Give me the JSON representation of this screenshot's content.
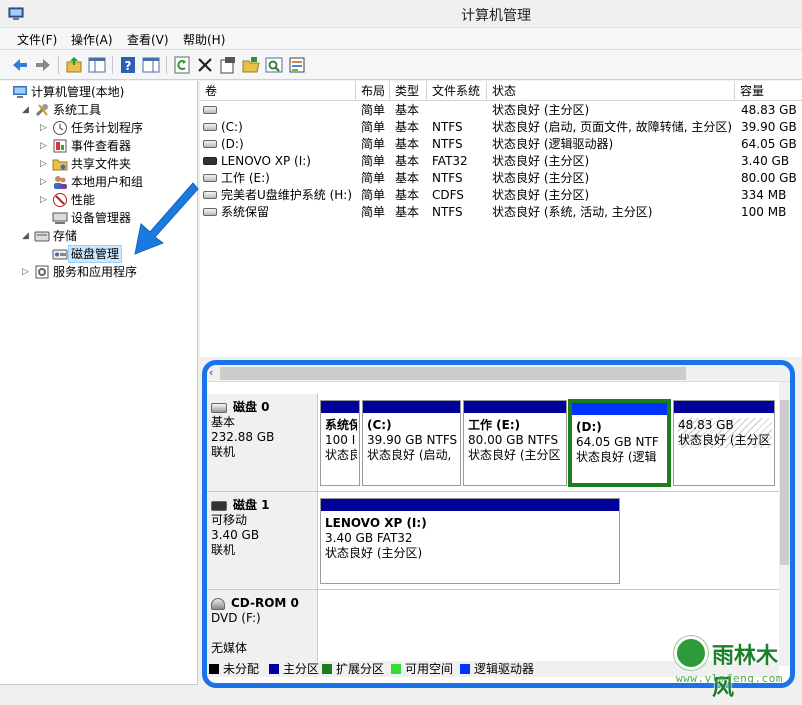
{
  "window": {
    "title": "计算机管理"
  },
  "menu": [
    "文件(F)",
    "操作(A)",
    "查看(V)",
    "帮助(H)"
  ],
  "toolbar": [
    "back-icon",
    "forward-icon",
    "up-folder-icon",
    "show-hide-tree-icon",
    "help-icon",
    "properties-pane-icon",
    "refresh-icon",
    "delete-icon",
    "properties-icon",
    "open-icon",
    "search-icon",
    "settings-icon"
  ],
  "tree": {
    "root": "计算机管理(本地)",
    "system_tools": "系统工具",
    "task_scheduler": "任务计划程序",
    "event_viewer": "事件查看器",
    "shared_folders": "共享文件夹",
    "local_users": "本地用户和组",
    "performance": "性能",
    "device_manager": "设备管理器",
    "storage": "存储",
    "disk_management": "磁盘管理",
    "services": "服务和应用程序"
  },
  "volumes": {
    "headers": [
      "卷",
      "布局",
      "类型",
      "文件系统",
      "状态",
      "容量"
    ],
    "rows": [
      {
        "name": "",
        "layout": "简单",
        "type": "基本",
        "fs": "",
        "status": "状态良好 (主分区)",
        "size": "48.83 GB",
        "usb": false
      },
      {
        "name": "(C:)",
        "layout": "简单",
        "type": "基本",
        "fs": "NTFS",
        "status": "状态良好 (启动, 页面文件, 故障转储, 主分区)",
        "size": "39.90 GB",
        "usb": false
      },
      {
        "name": "(D:)",
        "layout": "简单",
        "type": "基本",
        "fs": "NTFS",
        "status": "状态良好 (逻辑驱动器)",
        "size": "64.05 GB",
        "usb": false
      },
      {
        "name": "LENOVO XP (I:)",
        "layout": "简单",
        "type": "基本",
        "fs": "FAT32",
        "status": "状态良好 (主分区)",
        "size": "3.40 GB",
        "usb": true
      },
      {
        "name": "工作 (E:)",
        "layout": "简单",
        "type": "基本",
        "fs": "NTFS",
        "status": "状态良好 (主分区)",
        "size": "80.00 GB",
        "usb": false
      },
      {
        "name": "完美者U盘维护系统 (H:)",
        "layout": "简单",
        "type": "基本",
        "fs": "CDFS",
        "status": "状态良好 (主分区)",
        "size": "334 MB",
        "usb": false
      },
      {
        "name": "系统保留",
        "layout": "简单",
        "type": "基本",
        "fs": "NTFS",
        "status": "状态良好 (系统, 活动, 主分区)",
        "size": "100 MB",
        "usb": false
      }
    ]
  },
  "disks": [
    {
      "title": "磁盘 0",
      "line1": "基本",
      "line2": "232.88 GB",
      "line3": "联机",
      "partitions": [
        {
          "name": "系统保",
          "size": "100 I",
          "status": "状态良"
        },
        {
          "name": "(C:)",
          "size": "39.90 GB NTFS",
          "status": "状态良好 (启动,"
        },
        {
          "name": "工作  (E:)",
          "size": "80.00 GB NTFS",
          "status": "状态良好 (主分区"
        },
        {
          "name": "(D:)",
          "size": "64.05 GB NTF",
          "status": "状态良好 (逻辑"
        },
        {
          "name": "",
          "size": "48.83 GB",
          "status": "状态良好 (主分区"
        }
      ]
    },
    {
      "title": "磁盘 1",
      "line1": "可移动",
      "line2": "3.40 GB",
      "line3": "联机",
      "partitions": [
        {
          "name": "LENOVO XP  (I:)",
          "size": "3.40 GB FAT32",
          "status": "状态良好 (主分区)"
        }
      ]
    },
    {
      "title": "CD-ROM 0",
      "line1": "DVD (F:)",
      "line2": "",
      "line3": "无媒体",
      "partitions": []
    }
  ],
  "legend": [
    {
      "label": "未分配",
      "color": "#000000"
    },
    {
      "label": "主分区",
      "color": "#00009b"
    },
    {
      "label": "扩展分区",
      "color": "#1e7b1e"
    },
    {
      "label": "可用空间",
      "color": "#33dd33"
    },
    {
      "label": "逻辑驱动器",
      "color": "#0033ff"
    }
  ],
  "annotation": {
    "highlight_color": "#1a73e8"
  },
  "watermark": {
    "title": "雨林木风",
    "url": "www.ylmfeng.com"
  }
}
